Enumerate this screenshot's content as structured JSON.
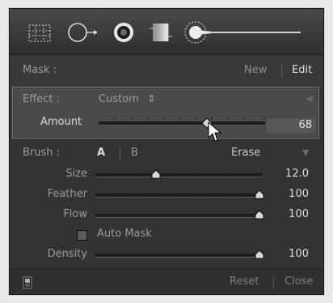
{
  "toolbar": {
    "tools": [
      "crop-overlay-icon",
      "spot-removal-icon",
      "red-eye-icon",
      "graduated-filter-icon",
      "adjustment-brush-icon"
    ]
  },
  "mask": {
    "label": "Mask :",
    "new_label": "New",
    "edit_label": "Edit"
  },
  "effect": {
    "label": "Effect :",
    "preset": "Custom",
    "preset_arrow": "⇕",
    "collapse_arrow": "◀"
  },
  "amount": {
    "label": "Amount",
    "value": "68",
    "position": 0.68
  },
  "brush": {
    "label": "Brush :",
    "a_label": "A",
    "b_label": "B",
    "erase_label": "Erase",
    "collapse_arrow": "▼",
    "rows": [
      {
        "label": "Size",
        "value": "12.0",
        "position": 0.36
      },
      {
        "label": "Feather",
        "value": "100",
        "position": 1.0
      },
      {
        "label": "Flow",
        "value": "100",
        "position": 1.0
      }
    ],
    "auto_mask_label": "Auto Mask",
    "density": {
      "label": "Density",
      "value": "100",
      "position": 1.0
    }
  },
  "footer": {
    "reset_label": "Reset",
    "close_label": "Close"
  }
}
